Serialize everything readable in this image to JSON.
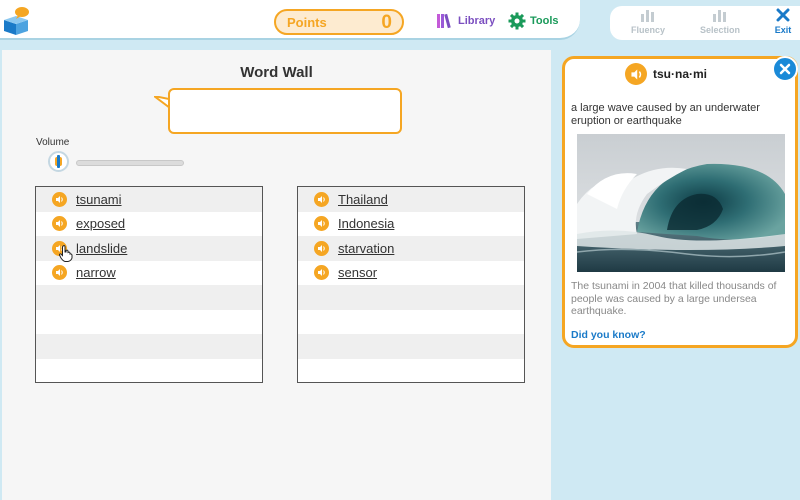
{
  "toolbar": {
    "points_label": "Points",
    "points_value": "0",
    "library_label": "Library",
    "tools_label": "Tools",
    "fluency_label": "Fluency",
    "selection_label": "Selection",
    "exit_label": "Exit"
  },
  "word_wall": {
    "title": "Word Wall",
    "volume_label": "Volume",
    "list_left": [
      {
        "word": "tsunami"
      },
      {
        "word": "exposed"
      },
      {
        "word": "landslide"
      },
      {
        "word": "narrow"
      }
    ],
    "list_right": [
      {
        "word": "Thailand"
      },
      {
        "word": "Indonesia"
      },
      {
        "word": "starvation"
      },
      {
        "word": "sensor"
      }
    ]
  },
  "definition_card": {
    "syllables": "tsu·na·mi",
    "definition": "a large wave caused by an underwater eruption or earthquake",
    "example": "The tsunami in 2004 that killed thousands of people was caused by a large undersea earthquake.",
    "did_you_know": "Did you know?"
  },
  "colors": {
    "accent_orange": "#f5a623",
    "link_blue": "#1a7ac8",
    "library_purple": "#7b4fc0",
    "tools_green": "#1a9a5a",
    "background": "#cfe9f3"
  },
  "icons": {
    "logo": "book-bubble-logo",
    "library": "books-icon",
    "tools": "gear-icon",
    "fluency": "bar-chart-icon",
    "selection": "bar-chart-icon",
    "exit": "close-icon",
    "speaker": "speaker-icon",
    "volume": "volume-icon",
    "cursor": "hand-pointer-icon"
  }
}
